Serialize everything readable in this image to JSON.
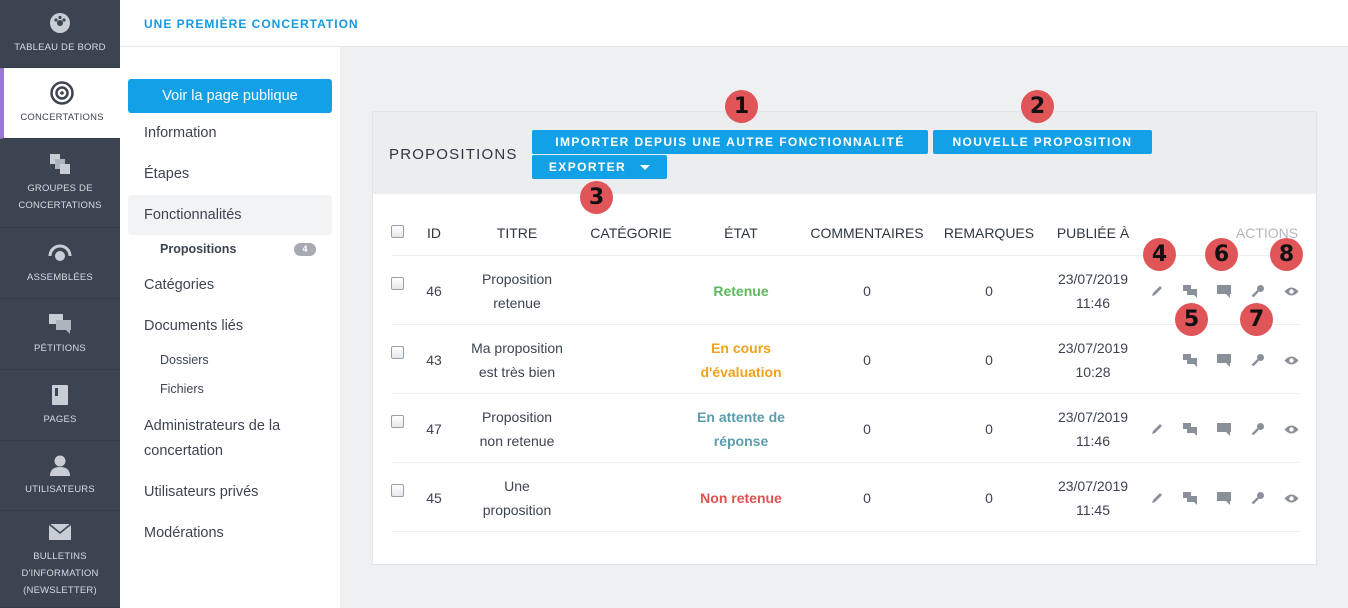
{
  "nav": {
    "items": [
      {
        "label": "TABLEAU DE BORD",
        "icon": "dashboard-icon"
      },
      {
        "label": "CONCERTATIONS",
        "icon": "target-icon"
      },
      {
        "label": "GROUPES DE CONCERTATIONS",
        "icon": "stacked-squares-icon"
      },
      {
        "label": "ASSEMBLÉES",
        "icon": "assembly-icon"
      },
      {
        "label": "PÉTITIONS",
        "icon": "chat-bubbles-icon"
      },
      {
        "label": "PAGES",
        "icon": "book-icon"
      },
      {
        "label": "UTILISATEURS",
        "icon": "user-icon"
      },
      {
        "label": "BULLETINS D'INFORMATION (NEWSLETTER)",
        "icon": "envelope-icon"
      }
    ],
    "active": "CONCERTATIONS"
  },
  "header": {
    "breadcrumb": "UNE PREMIÈRE CONCERTATION"
  },
  "subnav": {
    "public_button": "Voir la page publique",
    "information": "Information",
    "etapes": "Étapes",
    "fonctionnalites": "Fonctionnalités",
    "propositions": "Propositions",
    "propositions_count": "4",
    "categories": "Catégories",
    "documents": "Documents liés",
    "dossiers": "Dossiers",
    "fichiers": "Fichiers",
    "administrateurs_1": "Administrateurs de la",
    "administrateurs_2": "concertation",
    "utilisateurs_prives": "Utilisateurs privés",
    "moderations": "Modérations"
  },
  "panel": {
    "title": "PROPOSITIONS",
    "import_button": "IMPORTER DEPUIS UNE AUTRE FONCTIONNALITÉ",
    "new_button": "NOUVELLE PROPOSITION",
    "export_button": "EXPORTER"
  },
  "table": {
    "headers": {
      "id": "ID",
      "titre": "TITRE",
      "categorie": "CATÉGORIE",
      "etat": "ÉTAT",
      "commentaires": "COMMENTAIRES",
      "remarques": "REMARQUES",
      "publiee": "PUBLIÉE À",
      "actions": "ACTIONS"
    },
    "rows": [
      {
        "id": "46",
        "titre_1": "Proposition",
        "titre_2": "retenue",
        "etat_1": "Retenue",
        "etat_2": "",
        "etat_color": "#5cb85c",
        "commentaires": "0",
        "remarques": "0",
        "date": "23/07/2019",
        "time": "11:46"
      },
      {
        "id": "43",
        "titre_1": "Ma proposition",
        "titre_2": "est très bien",
        "etat_1": "En cours",
        "etat_2": "d'évaluation",
        "etat_color": "#f0a11d",
        "commentaires": "0",
        "remarques": "0",
        "date": "23/07/2019",
        "time": "10:28"
      },
      {
        "id": "47",
        "titre_1": "Proposition",
        "titre_2": "non retenue",
        "etat_1": "En attente de",
        "etat_2": "réponse",
        "etat_color": "#5b9cad",
        "commentaires": "0",
        "remarques": "0",
        "date": "23/07/2019",
        "time": "11:46"
      },
      {
        "id": "45",
        "titre_1": "Une",
        "titre_2": "proposition",
        "etat_1": "Non retenue",
        "etat_2": "",
        "etat_color": "#e0514f",
        "commentaires": "0",
        "remarques": "0",
        "date": "23/07/2019",
        "time": "11:45"
      }
    ]
  },
  "markers": [
    "1",
    "2",
    "3",
    "4",
    "5",
    "6",
    "7",
    "8"
  ],
  "colors": {
    "accent": "#12a1e6",
    "nav_bg": "#3d4451",
    "marker": "#e05558"
  }
}
